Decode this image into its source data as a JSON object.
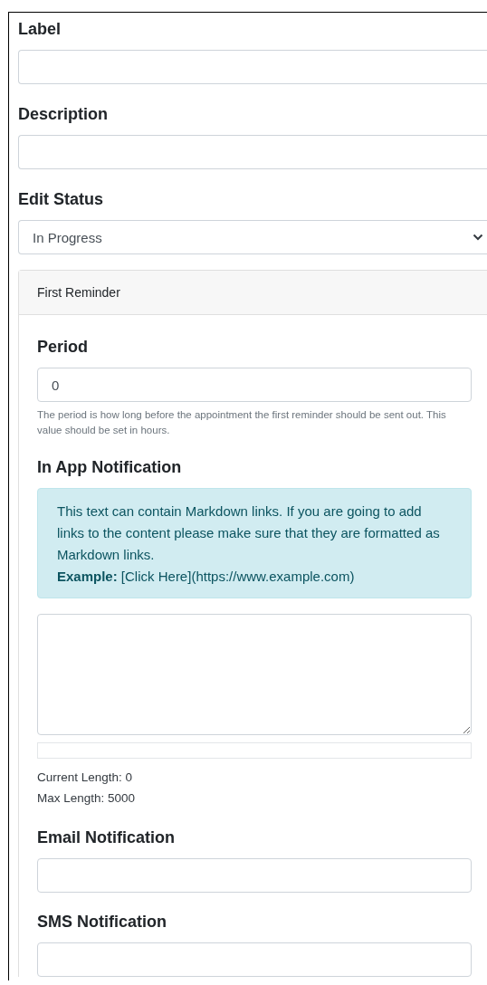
{
  "fields": [
    {
      "kind": "text",
      "label": "Label"
    },
    {
      "kind": "text",
      "label": "Description"
    },
    {
      "kind": "select",
      "label": "Edit Status",
      "value": "In Progress"
    }
  ],
  "reminder_card": {
    "title": "First Reminder",
    "fields": [
      {
        "kind": "text",
        "label": "Period",
        "value": "0",
        "help": "The period is how long before the appointment the first reminder should be sent out. This value should be set in hours."
      },
      {
        "kind": "textarea",
        "label": "In App Notification",
        "alert": {
          "text": "This text can contain Markdown links. If you are going to add links to the content please make sure that they are formatted as Markdown links.",
          "example": "**Example:** [Click Here](https://www.example.com)"
        },
        "length_bar": {
          "level": 0
        },
        "current_length": "Current Length: 0",
        "max_length": "Max Length: 5000"
      },
      {
        "kind": "text",
        "label": "Email Notification"
      },
      {
        "kind": "text",
        "label": "SMS Notification"
      }
    ]
  }
}
